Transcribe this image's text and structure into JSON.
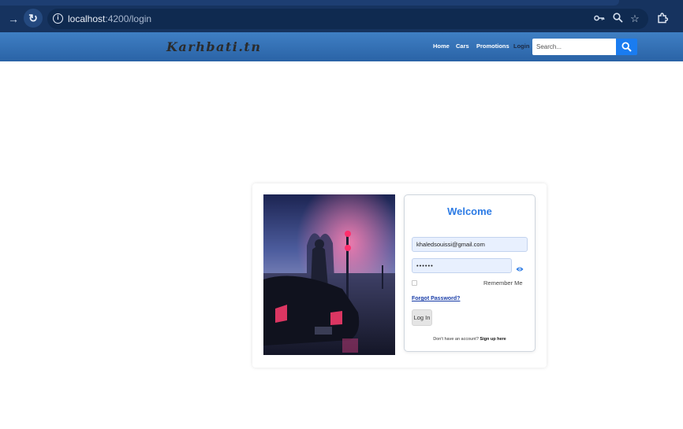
{
  "browser": {
    "url_host": "localhost",
    "url_path": ":4200/login",
    "icons": [
      "forward-arrow-icon",
      "reload-icon",
      "site-info-icon",
      "key-icon",
      "zoom-icon",
      "star-icon",
      "extensions-icon"
    ]
  },
  "header": {
    "logo": "Karhbati.tn",
    "nav": [
      "Home",
      "Cars",
      "Promotions",
      "Login"
    ],
    "search_placeholder": "Search..."
  },
  "login": {
    "title": "Welcome",
    "email_value": "khaledsouissi@gmail.com",
    "password_value": "••••••",
    "remember_label": "Remember Me",
    "forgot_label": "Forgot Password?",
    "login_button": "Log In",
    "signup_prompt": "Don't have an account?",
    "signup_link": "Sign up here"
  },
  "colors": {
    "header_bg": "#3672b8",
    "accent": "#2c7be5",
    "search_button": "#1a7cf0",
    "chrome_bg": "#16335f"
  }
}
